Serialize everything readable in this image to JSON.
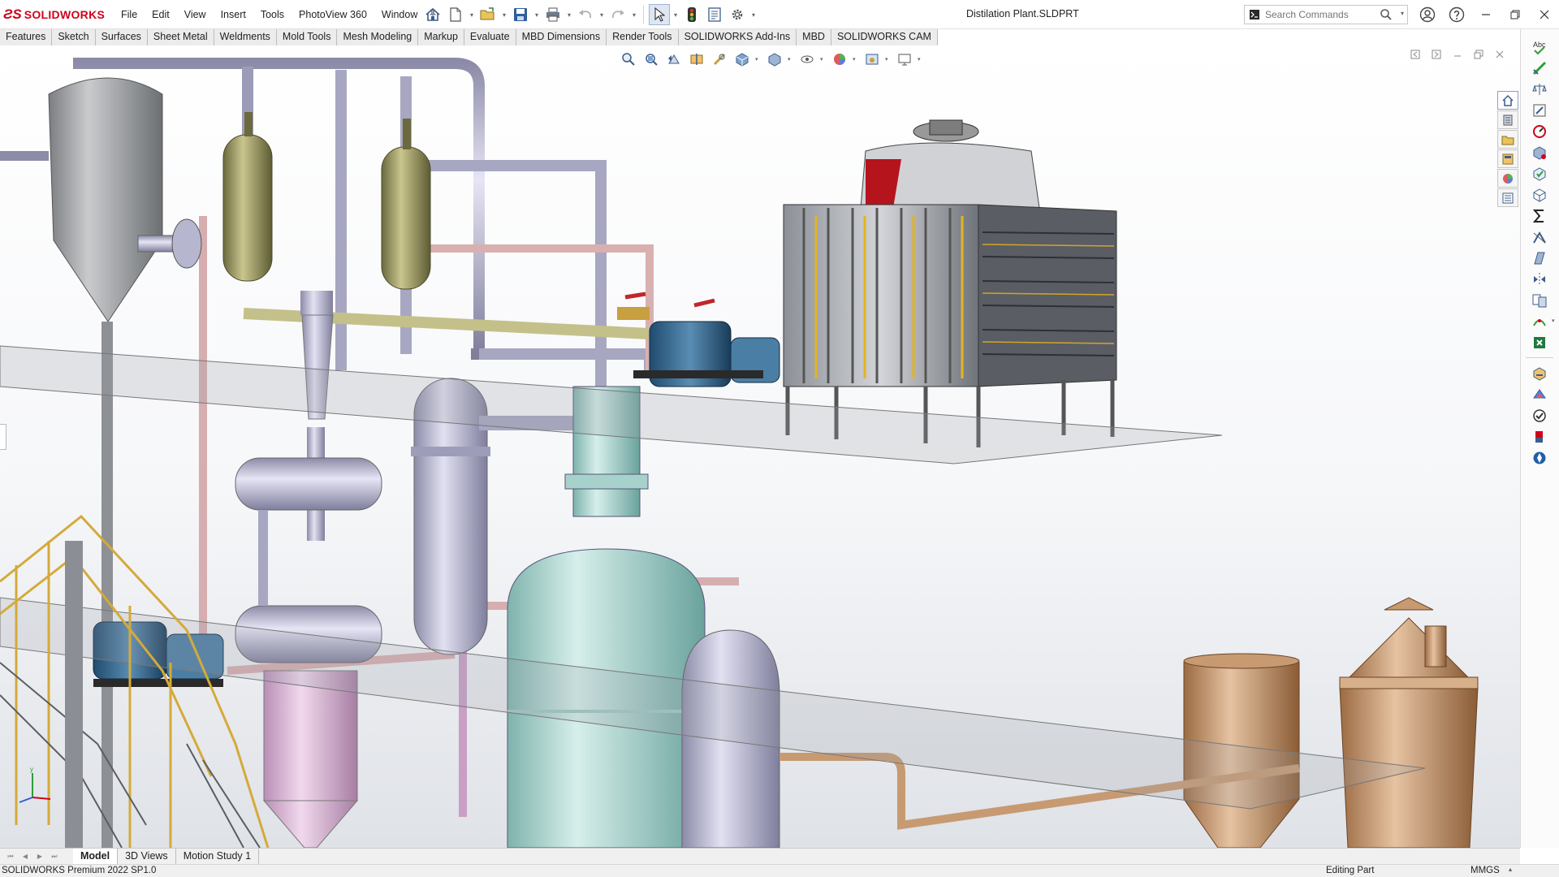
{
  "app": {
    "brand": "SOLIDWORKS",
    "document_title": "Distilation Plant.SLDPRT"
  },
  "menu": [
    "File",
    "Edit",
    "View",
    "Insert",
    "Tools",
    "PhotoView 360",
    "Window"
  ],
  "toolbar_icons": [
    "home-icon",
    "new-document-icon",
    "open-folder-icon",
    "save-icon",
    "print-icon",
    "undo-icon",
    "redo-icon",
    "select-arrow-icon",
    "traffic-light-icon",
    "file-properties-icon",
    "options-gear-icon"
  ],
  "search": {
    "placeholder": "Search Commands"
  },
  "command_tabs": [
    "Features",
    "Sketch",
    "Surfaces",
    "Sheet Metal",
    "Weldments",
    "Mold Tools",
    "Mesh Modeling",
    "Markup",
    "Evaluate",
    "MBD Dimensions",
    "Render Tools",
    "SOLIDWORKS Add-Ins",
    "MBD",
    "SOLIDWORKS CAM"
  ],
  "command_tab_active": "",
  "heads_up_icons": [
    "zoom-to-fit-icon",
    "zoom-area-icon",
    "previous-view-icon",
    "section-view-icon",
    "dynamic-annotation-icon",
    "view-orientation-icon",
    "display-style-icon",
    "hide-show-items-icon",
    "edit-appearance-icon",
    "apply-scene-icon",
    "view-settings-icon"
  ],
  "bottom_tabs": [
    "Model",
    "3D Views",
    "Motion Study 1"
  ],
  "bottom_tab_active": "Model",
  "status": {
    "product": "SOLIDWORKS Premium 2022 SP1.0",
    "mode": "Editing Part",
    "units": "MMGS"
  },
  "colors": {
    "brand_red": "#d0021b",
    "viewport_top": "#ffffff",
    "viewport_bottom": "#dfe2e7"
  }
}
